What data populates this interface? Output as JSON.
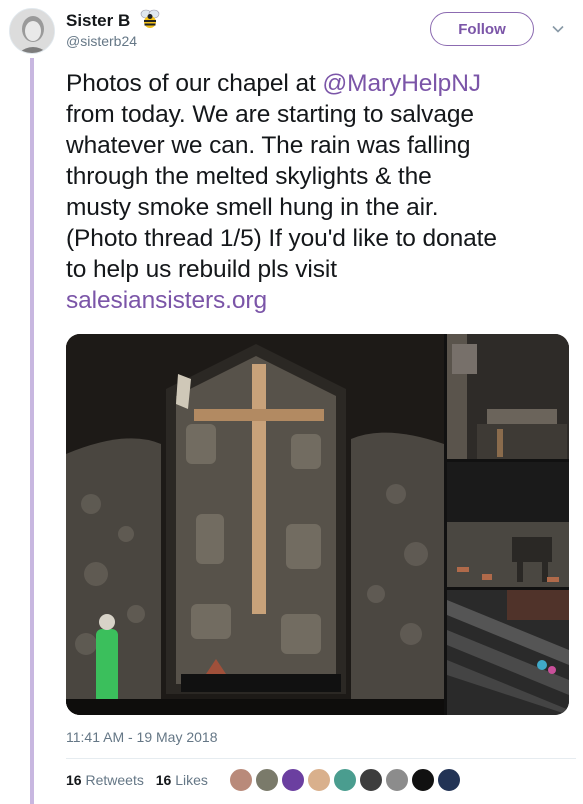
{
  "user": {
    "display_name": "Sister B",
    "handle": "@sisterb24",
    "badge_icon": "bee-icon",
    "avatar_icon": "avatar"
  },
  "actions": {
    "follow_label": "Follow",
    "menu_icon": "chevron-down-icon"
  },
  "tweet": {
    "lines": [
      {
        "pre": "Photos of our chapel at ",
        "mention": "@MaryHelpNJ"
      },
      {
        "text": "from today. We are starting to salvage"
      },
      {
        "text": "whatever we can. The rain was falling"
      },
      {
        "text": "through the melted skylights & the"
      },
      {
        "text": "musty smoke smell hung in the air."
      },
      {
        "text": "(Photo thread 1/5) If you'd like to donate"
      },
      {
        "text": "to help us rebuild pls visit"
      }
    ],
    "url": "salesiansisters.org"
  },
  "timestamp": "11:41 AM - 19 May 2018",
  "stats": {
    "retweets_count": "16",
    "retweets_label": "Retweets",
    "likes_count": "16",
    "likes_label": "Likes"
  },
  "colors": {
    "accent": "#7b55a8",
    "thread_line": "#c8b7e0",
    "muted": "#657786"
  },
  "likers": [
    {
      "name": "liker-avatar-1",
      "color": "#b98a7a"
    },
    {
      "name": "liker-avatar-2",
      "color": "#7a7a6a"
    },
    {
      "name": "liker-avatar-3",
      "color": "#6b3fa0"
    },
    {
      "name": "liker-avatar-4",
      "color": "#d9b08c"
    },
    {
      "name": "liker-avatar-5",
      "color": "#4a9d8f"
    },
    {
      "name": "liker-avatar-6",
      "color": "#3d3d3d"
    },
    {
      "name": "liker-avatar-7",
      "color": "#8c8c8c"
    },
    {
      "name": "liker-avatar-8",
      "color": "#111111"
    },
    {
      "name": "liker-avatar-9",
      "color": "#223355"
    }
  ]
}
